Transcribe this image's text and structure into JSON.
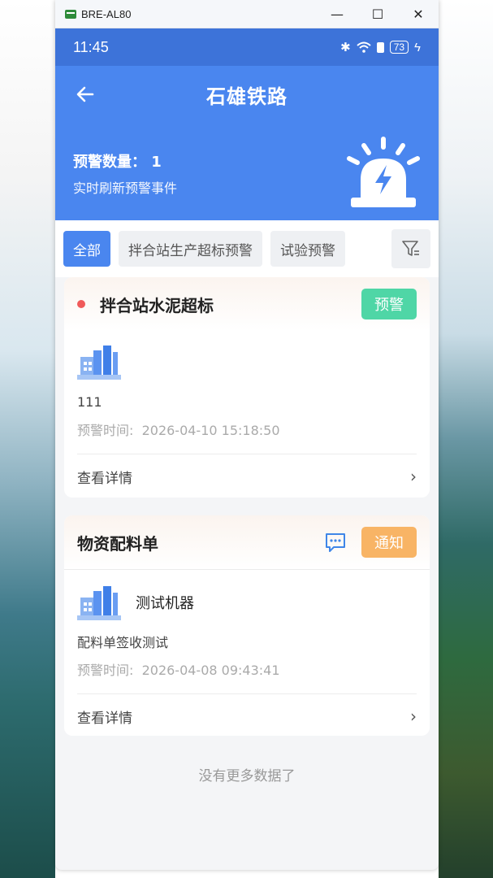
{
  "window": {
    "title": "BRE-AL80",
    "minimize": "—",
    "maximize": "☐",
    "close": "✕"
  },
  "status_bar": {
    "time": "11:45",
    "battery": "73"
  },
  "header": {
    "title": "石雄铁路",
    "warning_count_label": "预警数量：",
    "warning_count": "1",
    "subtitle": "实时刷新预警事件"
  },
  "tabs": [
    {
      "label": "全部",
      "active": true
    },
    {
      "label": "拌合站生产超标预警",
      "active": false
    },
    {
      "label": "试验预警",
      "active": false
    }
  ],
  "cards": [
    {
      "title": "拌合站水泥超标",
      "badge": "预警",
      "name": "",
      "content": "111",
      "time_label": "预警时间:",
      "time": "2026-04-10 15:18:50",
      "detail": "查看详情"
    },
    {
      "title": "物资配料单",
      "badge": "通知",
      "name": "测试机器",
      "content": "配料单签收测试",
      "time_label": "预警时间:",
      "time": "2026-04-08 09:43:41",
      "detail": "查看详情"
    }
  ],
  "footer": {
    "no_more": "没有更多数据了"
  },
  "colors": {
    "primary": "#4a86ef",
    "status_bar": "#3d73d9",
    "warning_badge": "#4fd6a6",
    "notice_badge": "#f8b465",
    "dot": "#f05a5a"
  }
}
